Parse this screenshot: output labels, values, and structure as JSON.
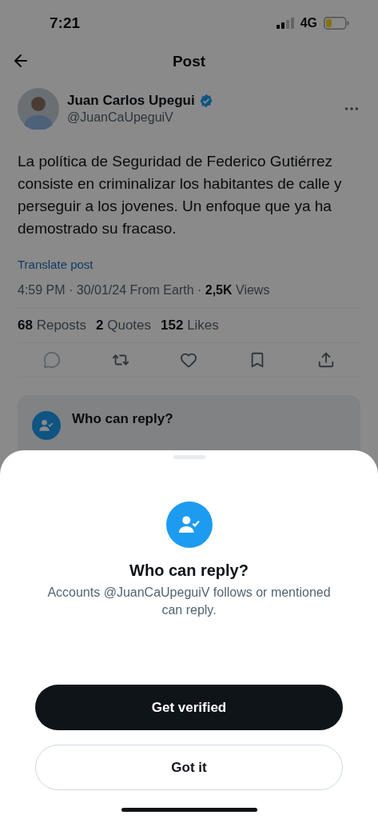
{
  "status_bar": {
    "time": "7:21",
    "network": "4G"
  },
  "header": {
    "title": "Post"
  },
  "post": {
    "author": {
      "name": "Juan Carlos Upegui",
      "handle": "@JuanCaUpeguiV",
      "verified": true
    },
    "text": "La política de Seguridad de Federico Gutiérrez consiste en criminalizar los habitantes de calle y perseguir a los jovenes. Un enfoque que ya ha demostrado su fracaso.",
    "translate": "Translate post",
    "meta": "4:59 PM · 30/01/24 From Earth · **2,5K** Views",
    "stats": [
      "**68** Reposts",
      "**2** Quotes",
      "**152** Likes"
    ],
    "actions": [
      {
        "kind": "reply",
        "disabled": true
      },
      {
        "kind": "repost",
        "disabled": false
      },
      {
        "kind": "like",
        "disabled": false
      },
      {
        "kind": "bookmark",
        "disabled": false
      },
      {
        "kind": "share",
        "disabled": false
      }
    ],
    "reply_notice": {
      "title": "Who can reply?"
    }
  },
  "sheet": {
    "title": "Who can reply?",
    "description": "Accounts @JuanCaUpeguiV follows or mentioned can reply.",
    "buttons": [
      {
        "label": "Get verified",
        "kind": "primary"
      },
      {
        "label": "Got it",
        "kind": "secondary"
      }
    ]
  }
}
